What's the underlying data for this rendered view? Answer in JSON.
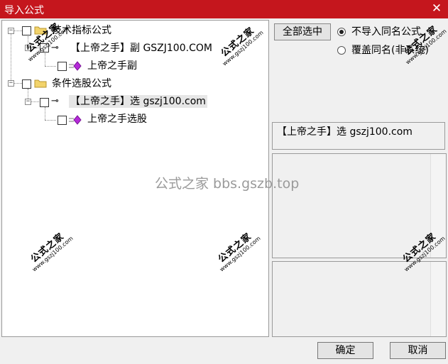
{
  "window": {
    "title": "导入公式",
    "close_glyph": "✕"
  },
  "tree": {
    "items": [
      {
        "label": "技术指标公式",
        "icon": "folder-icon",
        "checked": false
      },
      {
        "label": "【上帝之手】副 GSZJ100.COM",
        "icon": "key-icon",
        "checked": false
      },
      {
        "label": "上帝之手副",
        "icon": "formula-icon",
        "checked": false
      },
      {
        "label": "条件选股公式",
        "icon": "folder-icon",
        "checked": false
      },
      {
        "label": "【上帝之手】选 gszj100.com",
        "icon": "key-icon",
        "checked": false,
        "selected": true
      },
      {
        "label": "上帝之手选股",
        "icon": "formula-icon",
        "checked": false
      }
    ],
    "expander_minus": "−"
  },
  "controls": {
    "select_all_label": "全部选中",
    "option_skip_label": "不导入同名公式",
    "option_overwrite_label": "覆盖同名(非系统)",
    "selected_option": "skip"
  },
  "info": {
    "formula_name": "【上帝之手】选 gszj100.com"
  },
  "buttons": {
    "ok_label": "确定",
    "cancel_label": "取消"
  },
  "watermarks": {
    "title": "公式之家",
    "url": "www.gszj100.com",
    "center_text": "公式之家 bbs.gszb.top"
  },
  "colors": {
    "titlebar": "#c5161d",
    "folder": "#f2d36b",
    "formula": "#b42ad8"
  }
}
